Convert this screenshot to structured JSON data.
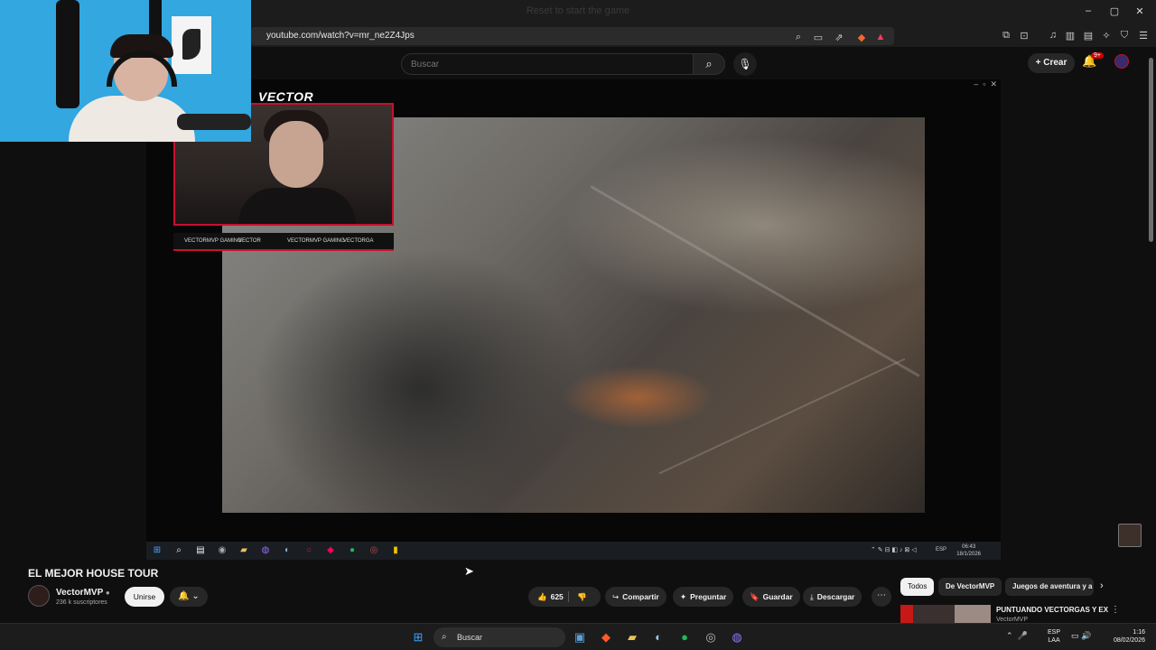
{
  "browser": {
    "window_title": "Reset to start the game",
    "url": "youtube.com/watch?v=mr_ne2Z4Jps"
  },
  "youtube_header": {
    "search_placeholder": "Buscar",
    "create_label": "Crear",
    "notification_badge": "9+"
  },
  "player": {
    "brand_text": "VECTOR",
    "social_items": [
      "VECTORMVP GAMING",
      "VECTOR",
      "VECTORMVP GAMING",
      "VECTORGA"
    ],
    "inner_clock": {
      "time": "06:43",
      "date": "18/1/2026"
    },
    "inner_lang": "ESP"
  },
  "video": {
    "title": "EL MEJOR HOUSE TOUR",
    "channel_name": "VectorMVP",
    "subscribers": "236 k suscriptores",
    "join_label": "Unirse",
    "like_count": "625",
    "actions": [
      "Compartir",
      "Preguntar",
      "Guardar",
      "Descargar"
    ]
  },
  "recommendations": {
    "chips": [
      "Todos",
      "De VectorMVP",
      "Juegos de aventura y a"
    ],
    "first_title": "PUNTUANDO VECTORGAS Y EX",
    "first_channel": "VectorMVP"
  },
  "taskbar": {
    "search_label": "Buscar",
    "lang_top": "ESP",
    "lang_bottom": "LAA",
    "time": "1:16",
    "date": "08/02/2026"
  },
  "colors": {
    "yt_dark": "#0f0f0f",
    "brand_red": "#c8102e",
    "cam_bg": "#32a7e0"
  }
}
